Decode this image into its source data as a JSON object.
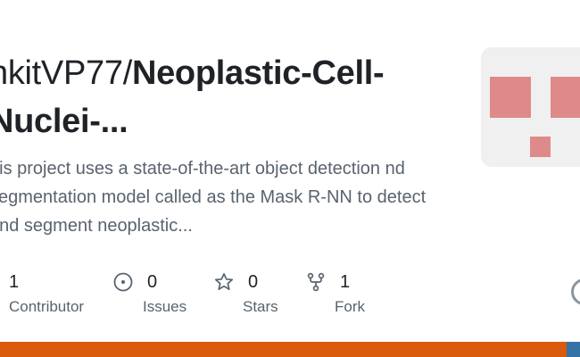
{
  "repo": {
    "owner_prefix": "nkitVP77/",
    "name": "Neoplastic-Cell-Nuclei-...",
    "description": "his project uses a state-of-the-art object detection nd segmentation model called as the Mask R-NN to detect and segment neoplastic..."
  },
  "stats": [
    {
      "icon": "people-icon",
      "count": "1",
      "label": "Contributor"
    },
    {
      "icon": "issue-opened-icon",
      "count": "0",
      "label": "Issues"
    },
    {
      "icon": "star-icon",
      "count": "0",
      "label": "Stars"
    },
    {
      "icon": "repo-forked-icon",
      "count": "1",
      "label": "Fork"
    }
  ],
  "colors": {
    "avatar_bg": "#f0f0f0",
    "avatar_blocks": "#de8a8a",
    "language_primary": "#da5b0b",
    "language_secondary": "#3572a5"
  },
  "language_shares": [
    0.977,
    0.023
  ]
}
